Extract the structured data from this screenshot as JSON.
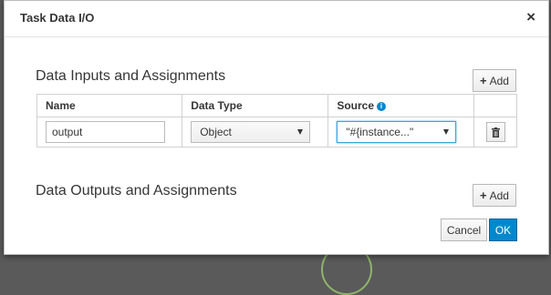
{
  "dialog": {
    "title": "Task Data I/O",
    "close_glyph": "×"
  },
  "inputs": {
    "section_title": "Data Inputs and Assignments",
    "add_label": "Add",
    "columns": {
      "name": "Name",
      "data_type": "Data Type",
      "source": "Source"
    },
    "rows": [
      {
        "name": "output",
        "data_type": "Object",
        "source": "\"#{instance...\""
      }
    ]
  },
  "outputs": {
    "section_title": "Data Outputs and Assignments",
    "add_label": "Add"
  },
  "footer": {
    "cancel_label": "Cancel",
    "ok_label": "OK"
  },
  "colors": {
    "primary": "#0088ce",
    "focus_border": "#39a5dc"
  },
  "icons": [
    "close-icon",
    "plus-icon",
    "info-icon",
    "caret-down-icon",
    "trash-icon"
  ]
}
